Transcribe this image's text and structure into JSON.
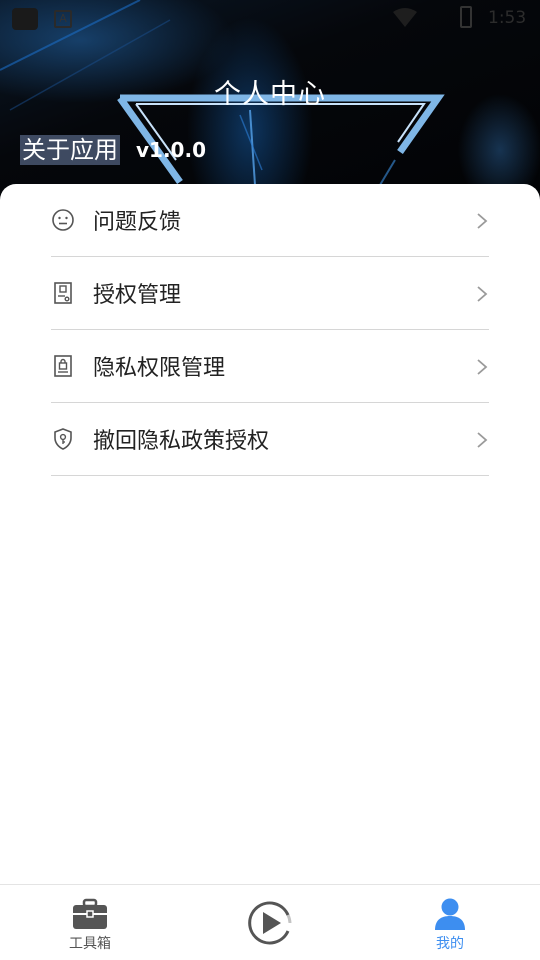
{
  "status_bar": {
    "time": "1:53"
  },
  "header": {
    "title": "个人中心",
    "about_label": "关于应用",
    "version": "v1.0.0"
  },
  "menu": {
    "items": [
      {
        "label": "问题反馈",
        "icon": "smiley-face-icon"
      },
      {
        "label": "授权管理",
        "icon": "document-stamp-icon"
      },
      {
        "label": "隐私权限管理",
        "icon": "lock-document-icon"
      },
      {
        "label": "撤回隐私政策授权",
        "icon": "shield-key-icon"
      }
    ]
  },
  "bottom_nav": {
    "toolbox_label": "工具箱",
    "mine_label": "我的",
    "active_color": "#3d8ef0",
    "inactive_color": "#555555"
  }
}
